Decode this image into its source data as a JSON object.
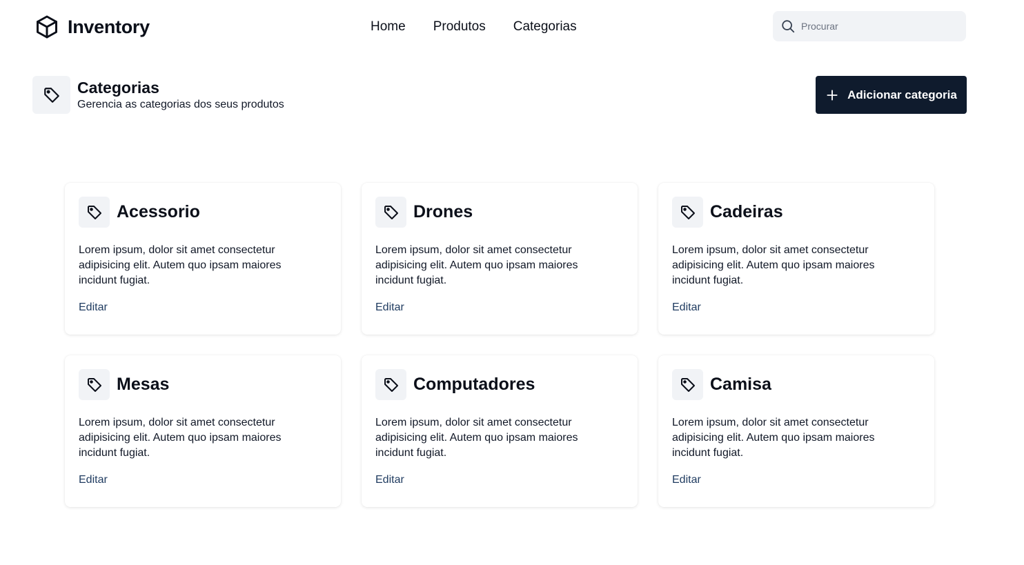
{
  "brand": {
    "name": "Inventory",
    "icon": "box-icon"
  },
  "nav": {
    "items": [
      "Home",
      "Produtos",
      "Categorias"
    ]
  },
  "search": {
    "placeholder": "Procurar",
    "value": "",
    "icon": "search-icon"
  },
  "page": {
    "title": "Categorias",
    "subtitle": "Gerencia as categorias dos seus produtos",
    "icon": "tag-icon"
  },
  "actions": {
    "add_label": "Adicionar categoria",
    "add_icon": "plus-icon"
  },
  "categories": [
    {
      "name": "Acessorio",
      "description": "Lorem ipsum, dolor sit amet consectetur adipisicing elit. Autem quo ipsam maiores incidunt fugiat.",
      "edit_label": "Editar"
    },
    {
      "name": "Drones",
      "description": "Lorem ipsum, dolor sit amet consectetur adipisicing elit. Autem quo ipsam maiores incidunt fugiat.",
      "edit_label": "Editar"
    },
    {
      "name": "Cadeiras",
      "description": "Lorem ipsum, dolor sit amet consectetur adipisicing elit. Autem quo ipsam maiores incidunt fugiat.",
      "edit_label": "Editar"
    },
    {
      "name": "Mesas",
      "description": "Lorem ipsum, dolor sit amet consectetur adipisicing elit. Autem quo ipsam maiores incidunt fugiat.",
      "edit_label": "Editar"
    },
    {
      "name": "Computadores",
      "description": "Lorem ipsum, dolor sit amet consectetur adipisicing elit. Autem quo ipsam maiores incidunt fugiat.",
      "edit_label": "Editar"
    },
    {
      "name": "Camisa",
      "description": "Lorem ipsum, dolor sit amet consectetur adipisicing elit. Autem quo ipsam maiores incidunt fugiat.",
      "edit_label": "Editar"
    }
  ],
  "colors": {
    "primary_button": "#0f1b2d",
    "icon_bg": "#f1f3f6",
    "link": "#1e3a5f"
  }
}
